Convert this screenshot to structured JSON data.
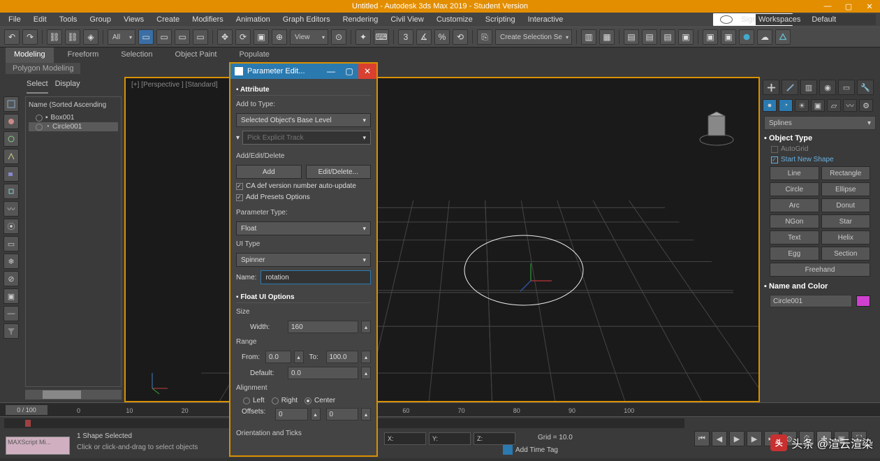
{
  "title": "Untitled - Autodesk 3ds Max 2019 - Student Version",
  "menu": [
    "File",
    "Edit",
    "Tools",
    "Group",
    "Views",
    "Create",
    "Modifiers",
    "Animation",
    "Graph Editors",
    "Rendering",
    "Civil View",
    "Customize",
    "Scripting",
    "Interactive"
  ],
  "signin": "Sign In",
  "menuRight": [
    "Workspaces",
    "Default"
  ],
  "ribbon": [
    "Modeling",
    "Freeform",
    "Selection",
    "Object Paint",
    "Populate"
  ],
  "ribbon2": "Polygon Modeling",
  "leftTabs": [
    "Select",
    "Display"
  ],
  "tree": {
    "head": "Name (Sorted Ascending",
    "row1": "Box001",
    "row2": "Circle001"
  },
  "viewport": {
    "label": "[+] [Perspective ] [Standard]"
  },
  "dialog": {
    "title": "Parameter Edit...",
    "roll_attribute": "Attribute",
    "addto": "Add to Type:",
    "addto_val": "Selected Object's Base Level",
    "picktrack": "Pick Explicit Track",
    "aed": "Add/Edit/Delete",
    "btn_add": "Add",
    "btn_editdel": "Edit/Delete...",
    "chk_ca": "CA def version number auto-update",
    "chk_presets": "Add Presets Options",
    "ptype": "Parameter Type:",
    "ptype_val": "Float",
    "uitype": "UI Type",
    "uitype_val": "Spinner",
    "name_lbl": "Name:",
    "name_val": "rotation",
    "roll_float": "Float UI Options",
    "size": "Size",
    "width": "Width:",
    "width_val": "160",
    "range": "Range",
    "from": "From:",
    "from_val": "0.0",
    "to": "To:",
    "to_val": "100.0",
    "default": "Default:",
    "default_val": "0.0",
    "align": "Alignment",
    "al_left": "Left",
    "al_right": "Right",
    "al_center": "Center",
    "offsets": "Offsets:",
    "off_x": "0",
    "off_y": "0",
    "roll_orient": "Orientation and Ticks"
  },
  "cmdpanel": {
    "dropdown": "Splines",
    "roll_objtype": "Object Type",
    "autogrid": "AutoGrid",
    "startshape": "Start New Shape",
    "buttons": [
      "Line",
      "Rectangle",
      "Circle",
      "Ellipse",
      "Arc",
      "Donut",
      "NGon",
      "Star",
      "Text",
      "Helix",
      "Egg",
      "Section",
      "Freehand"
    ],
    "roll_namecolor": "Name and Color",
    "objname": "Circle001"
  },
  "timeline": {
    "frame": "0 / 100"
  },
  "status": {
    "sel": "1 Shape Selected",
    "hint": "Click or click-and-drag to select objects",
    "script": "MAXScript Mi...",
    "grid": "Grid = 10.0",
    "timetag": "Add Time Tag"
  },
  "watermark": "头条 @渲云渲染"
}
